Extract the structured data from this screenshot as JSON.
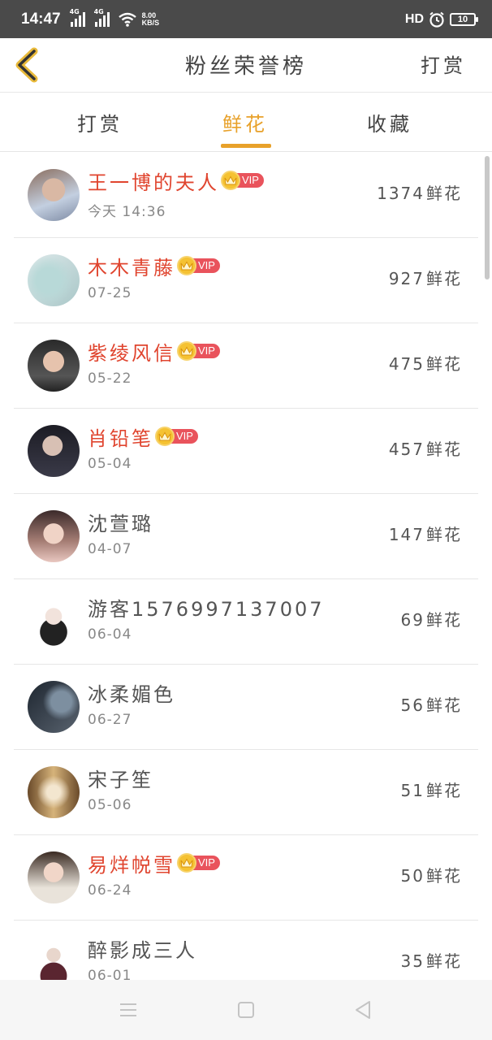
{
  "status_bar": {
    "time": "14:47",
    "signal_1": "4G",
    "signal_2": "4G",
    "speed_value": "8.00",
    "speed_unit": "KB/S",
    "hd": "HD",
    "battery": "10"
  },
  "header": {
    "title": "粉丝荣誉榜",
    "right_action": "打赏"
  },
  "tabs": [
    {
      "label": "打赏",
      "active": false
    },
    {
      "label": "鲜花",
      "active": true
    },
    {
      "label": "收藏",
      "active": false
    }
  ],
  "accent_color": "#e8a12a",
  "vip_name_color": "#e0452f",
  "vip_label": "VIP",
  "unit": "鲜花",
  "rows": [
    {
      "name": "王一博的夫人",
      "vip": true,
      "date": "今天 14:36",
      "count": "1374"
    },
    {
      "name": "木木青藤",
      "vip": true,
      "date": "07-25",
      "count": "927"
    },
    {
      "name": "紫绫风信",
      "vip": true,
      "date": "05-22",
      "count": "475"
    },
    {
      "name": "肖铅笔",
      "vip": true,
      "date": "05-04",
      "count": "457"
    },
    {
      "name": "沈萱璐",
      "vip": false,
      "date": "04-07",
      "count": "147"
    },
    {
      "name": "游客1576997137007",
      "vip": false,
      "date": "06-04",
      "count": "69"
    },
    {
      "name": "冰柔媚色",
      "vip": false,
      "date": "06-27",
      "count": "56"
    },
    {
      "name": "宋子笙",
      "vip": false,
      "date": "05-06",
      "count": "51"
    },
    {
      "name": "易烊帨雪",
      "vip": true,
      "date": "06-24",
      "count": "50"
    },
    {
      "name": "醉影成三人",
      "vip": false,
      "date": "06-01",
      "count": "35"
    }
  ]
}
